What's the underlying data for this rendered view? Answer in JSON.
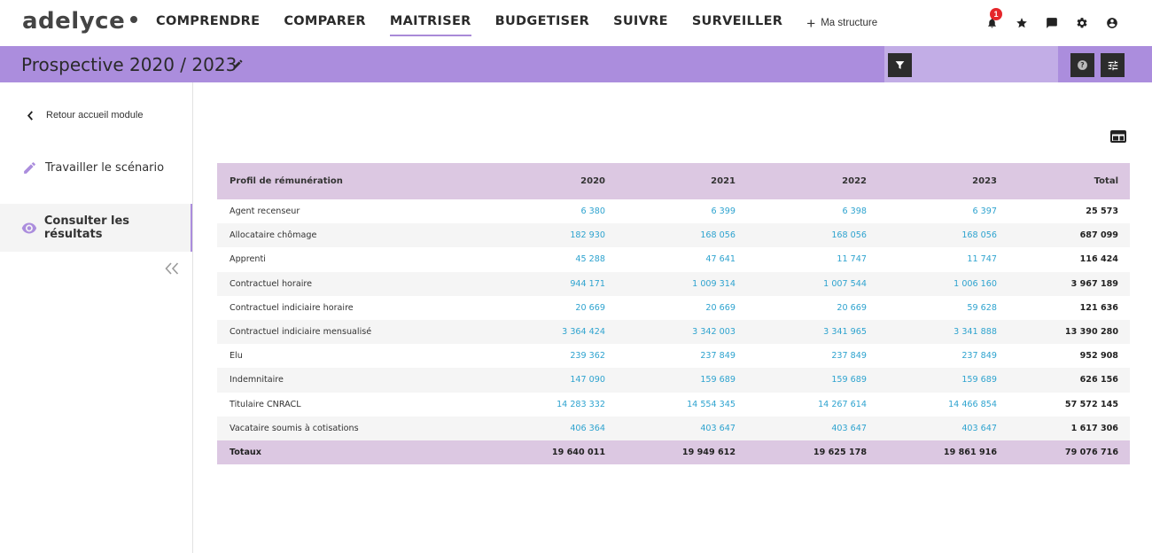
{
  "app": {
    "logo": "adelyce"
  },
  "nav": {
    "items": [
      {
        "label": "COMPRENDRE",
        "active": false
      },
      {
        "label": "COMPARER",
        "active": false
      },
      {
        "label": "MAITRISER",
        "active": true
      },
      {
        "label": "BUDGETISER",
        "active": false
      },
      {
        "label": "SUIVRE",
        "active": false
      },
      {
        "label": "SURVEILLER",
        "active": false
      }
    ],
    "add_label": "Ma structure",
    "notification_count": "1"
  },
  "header": {
    "title": "Prospective 2020 / 2023"
  },
  "sidebar": {
    "back_label": "Retour accueil module",
    "items": [
      {
        "label": "Travailler le scénario",
        "icon": "pencil-icon",
        "active": false
      },
      {
        "label": "Consulter les résultats",
        "icon": "eye-icon",
        "active": true
      }
    ]
  },
  "colors": {
    "accent": "#ab8ddd",
    "header_row": "#dcc8e2",
    "link_value": "#2ea3cf",
    "badge": "#e5262a"
  },
  "table": {
    "columns": [
      "Profil de rémunération",
      "2020",
      "2021",
      "2022",
      "2023",
      "Total"
    ],
    "rows": [
      [
        "Agent recenseur",
        "6 380",
        "6 399",
        "6 398",
        "6 397",
        "25 573"
      ],
      [
        "Allocataire chômage",
        "182 930",
        "168 056",
        "168 056",
        "168 056",
        "687 099"
      ],
      [
        "Apprenti",
        "45 288",
        "47 641",
        "11 747",
        "11 747",
        "116 424"
      ],
      [
        "Contractuel horaire",
        "944 171",
        "1 009 314",
        "1 007 544",
        "1 006 160",
        "3 967 189"
      ],
      [
        "Contractuel indiciaire horaire",
        "20 669",
        "20 669",
        "20 669",
        "59 628",
        "121 636"
      ],
      [
        "Contractuel indiciaire mensualisé",
        "3 364 424",
        "3 342 003",
        "3 341 965",
        "3 341 888",
        "13 390 280"
      ],
      [
        "Elu",
        "239 362",
        "237 849",
        "237 849",
        "237 849",
        "952 908"
      ],
      [
        "Indemnitaire",
        "147 090",
        "159 689",
        "159 689",
        "159 689",
        "626 156"
      ],
      [
        "Titulaire CNRACL",
        "14 283 332",
        "14 554 345",
        "14 267 614",
        "14 466 854",
        "57 572 145"
      ],
      [
        "Vacataire soumis à cotisations",
        "406 364",
        "403 647",
        "403 647",
        "403 647",
        "1 617 306"
      ]
    ],
    "totals": [
      "Totaux",
      "19 640 011",
      "19 949 612",
      "19 625 178",
      "19 861 916",
      "79 076 716"
    ]
  }
}
